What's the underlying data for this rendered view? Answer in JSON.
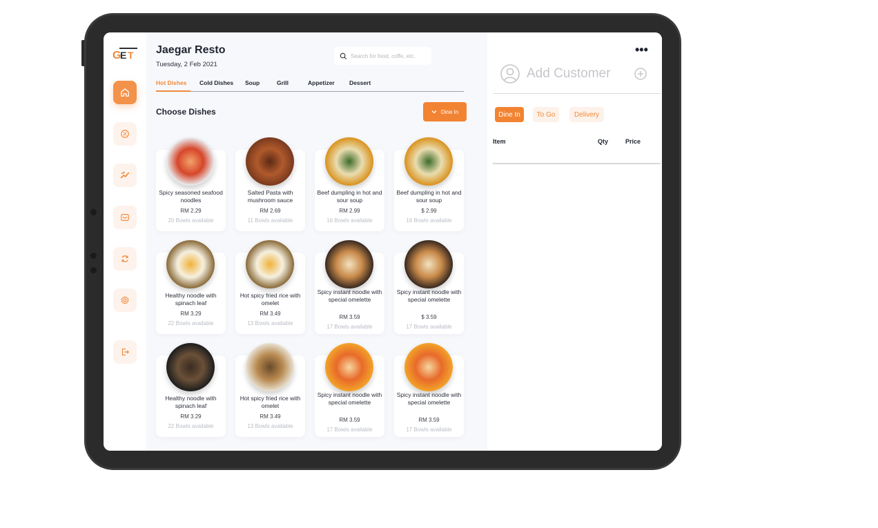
{
  "app": {
    "title": "Jaegar Resto",
    "date": "Tuesday, 2 Feb 2021",
    "logo_text": "GET"
  },
  "search": {
    "placeholder": "Search for food, coffe, etc.."
  },
  "sidebar": {
    "items": [
      {
        "icon": "home-icon",
        "active": true
      },
      {
        "icon": "discount-icon",
        "active": false
      },
      {
        "icon": "dashboard-icon",
        "active": false
      },
      {
        "icon": "message-icon",
        "active": false
      },
      {
        "icon": "notification-icon",
        "active": false
      },
      {
        "icon": "settings-icon",
        "active": false
      },
      {
        "icon": "logout-icon",
        "active": false
      }
    ]
  },
  "tabs": [
    "Hot Dishes",
    "Cold Dishes",
    "Soup",
    "Grill",
    "Appetizer",
    "Dessert"
  ],
  "section_title": "Choose Dishes",
  "dine_filter": "Dine In",
  "dishes": [
    {
      "name": "Spicy seasoned seafood noodles",
      "price": "RM 2.29",
      "avail": "20 Bowls available",
      "colors": [
        "#e9ecef",
        "#d6462a",
        "#f2a26b"
      ]
    },
    {
      "name": "Salted Pasta with mushroom sauce",
      "price": "RM 2.69",
      "avail": "11 Bowls available",
      "colors": [
        "#7a3a1e",
        "#b05a2c",
        "#5c2a15"
      ]
    },
    {
      "name": "Beef dumpling in hot and sour soup",
      "price": "RM 2.99",
      "avail": "16 Bowls available",
      "colors": [
        "#d9931f",
        "#eaddb0",
        "#3d6b2a"
      ]
    },
    {
      "name": "Beef dumpling in hot and sour soup",
      "price": "$ 2.99",
      "avail": "16 Bowls available",
      "colors": [
        "#d9931f",
        "#eaddb0",
        "#3d6b2a"
      ]
    },
    {
      "name": "Healthy noodle with spinach leaf",
      "price": "RM 3.29",
      "avail": "22 Bowls available",
      "colors": [
        "#8a6b3a",
        "#f6f0e0",
        "#f0b23a"
      ]
    },
    {
      "name": "Hot spicy fried rice with omelet",
      "price": "RM 3.49",
      "avail": "13 Bowls available",
      "colors": [
        "#8a6b3a",
        "#f6f0e0",
        "#f0b23a"
      ]
    },
    {
      "name": "Spicy instant noodle with special omelette",
      "price": "RM 3.59",
      "avail": "17 Bowls available",
      "colors": [
        "#3a2a20",
        "#c98a4a",
        "#f2e2c0"
      ]
    },
    {
      "name": "Spicy instant noodle with special omelette",
      "price": "$ 3.59",
      "avail": "17 Bowls available",
      "colors": [
        "#3a2a20",
        "#c98a4a",
        "#f2e2c0"
      ]
    },
    {
      "name": "Healthy noodle with spinach leaf",
      "price": "RM 3.29",
      "avail": "22 Bowls available",
      "colors": [
        "#1e1e1e",
        "#6a5038",
        "#3a2c20"
      ]
    },
    {
      "name": "Hot spicy fried rice with omelet",
      "price": "RM 3.49",
      "avail": "13 Bowls available",
      "colors": [
        "#e8e0d0",
        "#b88a50",
        "#6a4a2a"
      ]
    },
    {
      "name": "Spicy instant noodle with special omelette",
      "price": "RM 3.59",
      "avail": "17 Bowls available",
      "colors": [
        "#f2a22a",
        "#e86a2a",
        "#f6d6a0"
      ]
    },
    {
      "name": "Spicy instant noodle with special omelette",
      "price": "RM 3.59",
      "avail": "17 Bowls available",
      "colors": [
        "#f2a22a",
        "#e86a2a",
        "#f6d6a0"
      ]
    }
  ],
  "order": {
    "add_customer": "Add Customer",
    "types": [
      "Dine In",
      "To Go",
      "Delivery"
    ],
    "columns": {
      "item": "Item",
      "qty": "Qty",
      "price": "Price"
    }
  },
  "colors": {
    "accent": "#f28332",
    "text": "#1f2430",
    "muted": "#b9bdc4"
  }
}
